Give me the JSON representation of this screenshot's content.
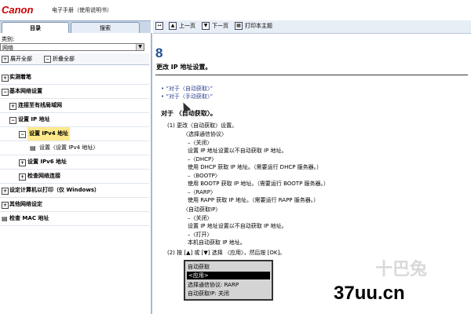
{
  "header": {
    "logo": "Canon",
    "doc_title": "电子手册（使用说明书）"
  },
  "tabs": [
    {
      "label": "目录"
    },
    {
      "label": "搜索"
    }
  ],
  "sidebar": {
    "category_label": "类别:",
    "category_value": "网络",
    "expand_all": "展开全部",
    "collapse_all": "折叠全部",
    "items": [
      {
        "label": "实测着笔"
      },
      {
        "label": "基本网络设置"
      },
      {
        "label": "连接至有线局域网"
      },
      {
        "label": "设置 IP 地址"
      },
      {
        "label": "设置 IPv4 地址"
      },
      {
        "label": "设置〈设置 IPv4 地址〉"
      },
      {
        "label": "设置 IPv6 地址"
      },
      {
        "label": "检查网络连接"
      },
      {
        "label": "设定计算机以打印（仅 Windows）"
      },
      {
        "label": "其他网络设定"
      },
      {
        "label": "检查 MAC 地址"
      }
    ]
  },
  "toolbar": {
    "prev": "上一页",
    "next": "下一页",
    "print": "打印本主题"
  },
  "content": {
    "chapter": "8",
    "title": "更改 IP 地址设置。",
    "links": [
      "“对于〈自动获取〉”",
      "“对于〈手动获取〉”"
    ],
    "section_heading": "对于 〈自动获取〉。",
    "lines": [
      "(1) 更改〈自动获取〉设置。",
      "〈选择通信协议〉",
      "–〈关闭〉",
      "设置 IP 地址设置以不自动获取 IP 地址。",
      "–〈DHCP〉",
      "使用 DHCP 获取 IP 地址。（需要运行 DHCP 服务器。）",
      "–〈BOOTP〉",
      "使用 BOOTP 获取 IP 地址。（需要运行 BOOTP 服务器。）",
      "–〈RARP〉",
      "使用 RAPP 获取 IP 地址。（需要运行 RAPP 服务器。）",
      "〈自动获取IP〉",
      "–〈关闭〉",
      "设置 IP 地址设置以不自动获取 IP 地址。",
      "–〈打开〉",
      "本机自动获取 IP 地址。",
      "(2) 按 [▲] 或 [▼] 选择 〈应用〉，然后按 [OK]。"
    ],
    "lcd": [
      "自动获取",
      "<应用>",
      "选择通信协议: RARP",
      "自动获取IP: 关闭"
    ]
  },
  "watermark": {
    "top": "十巴兔",
    "bottom": "37uu.cn"
  }
}
